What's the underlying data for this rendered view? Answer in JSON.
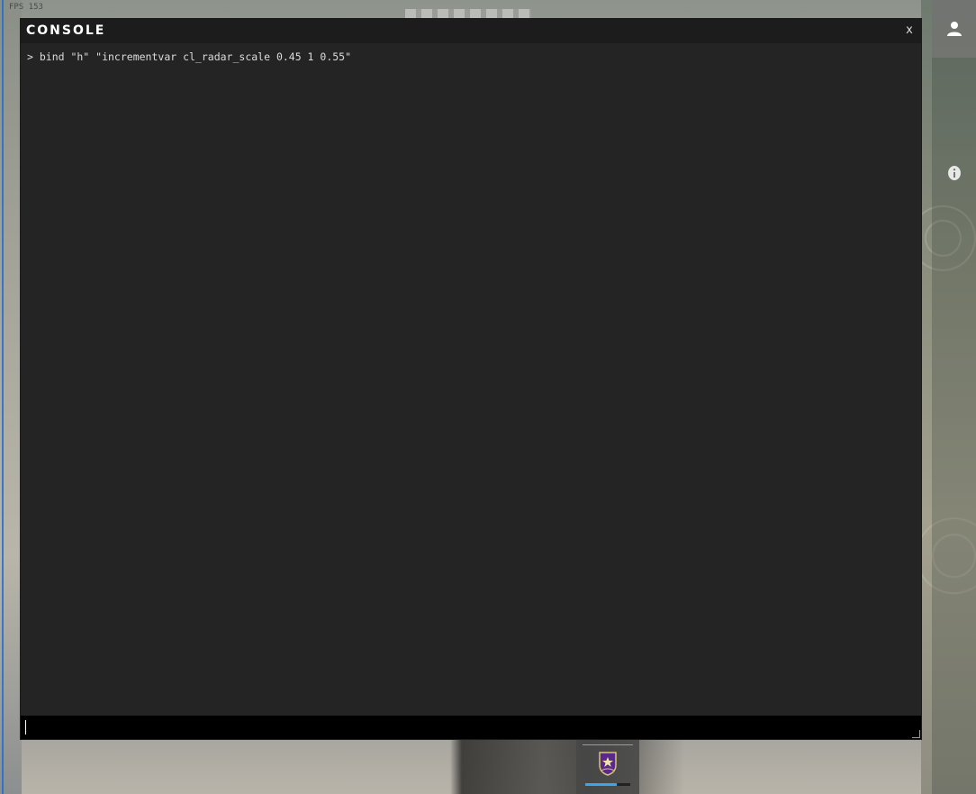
{
  "background": {
    "corner_text": "FPS 153"
  },
  "console": {
    "title": "CONSOLE",
    "close_label": "x",
    "output_lines": [
      "> bind \"h\" \"incrementvar cl_radar_scale 0.45 1 0.55\""
    ],
    "input_value": "",
    "input_placeholder": ""
  },
  "sidebar": {
    "items": [
      {
        "icon": "profile-icon"
      },
      {
        "icon": "info-icon"
      }
    ]
  },
  "rank": {
    "icon": "rank-emblem-icon",
    "xp_progress": 0.7
  },
  "colors": {
    "console_bg": "#242424",
    "titlebar_bg": "#1c1c1c",
    "input_bg": "#000000",
    "xp_bar": "#3aa6e8"
  }
}
